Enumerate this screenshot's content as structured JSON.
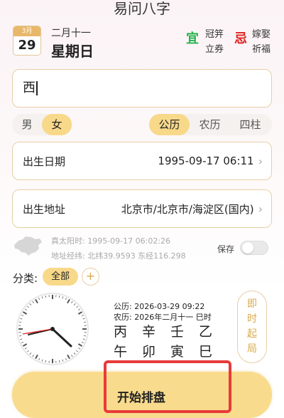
{
  "app": {
    "title": "易问八字"
  },
  "header": {
    "month_badge": "3月",
    "day_badge": "29",
    "lunar_date": "二月十一",
    "weekday": "星期日",
    "yi_label": "宜",
    "yi_items": [
      "冠笄",
      "立券"
    ],
    "ji_label": "忌",
    "ji_items": [
      "嫁娶",
      "祈福"
    ]
  },
  "form": {
    "name_value": "西",
    "gender_options": [
      "男",
      "女"
    ],
    "gender_selected": "女",
    "calendar_options": [
      "公历",
      "农历",
      "四柱"
    ],
    "calendar_selected": "公历",
    "birth_date_label": "出生日期",
    "birth_date_value": "1995-09-17 06:11",
    "birth_place_label": "出生地址",
    "birth_place_value": "北京市/北京市/海淀区(国内)",
    "solar_time": "真太阳时: 1995-09-17 06:02:26",
    "coords": "地址经纬: 北纬39.9593  东经116.298",
    "save_label": "保存",
    "save_enabled": false
  },
  "category": {
    "label": "分类:",
    "all_label": "全部",
    "add_label": "+"
  },
  "bazi": {
    "solar": "公历: 2026-03-29 09:22",
    "lunar": "农历: 2026年二月十一 巳时",
    "heavenly_stems": [
      "丙",
      "辛",
      "壬",
      "乙"
    ],
    "earthly_branches": [
      "午",
      "卯",
      "寅",
      "巳"
    ],
    "instant_chars": [
      "即",
      "时",
      "起",
      "局"
    ]
  },
  "actions": {
    "start_label": "开始排盘"
  },
  "colors": {
    "accent": "#f8d98a",
    "border": "#e6cfa6",
    "yi": "#22b44a",
    "ji": "#e02020",
    "highlight": "#e83a3a"
  }
}
